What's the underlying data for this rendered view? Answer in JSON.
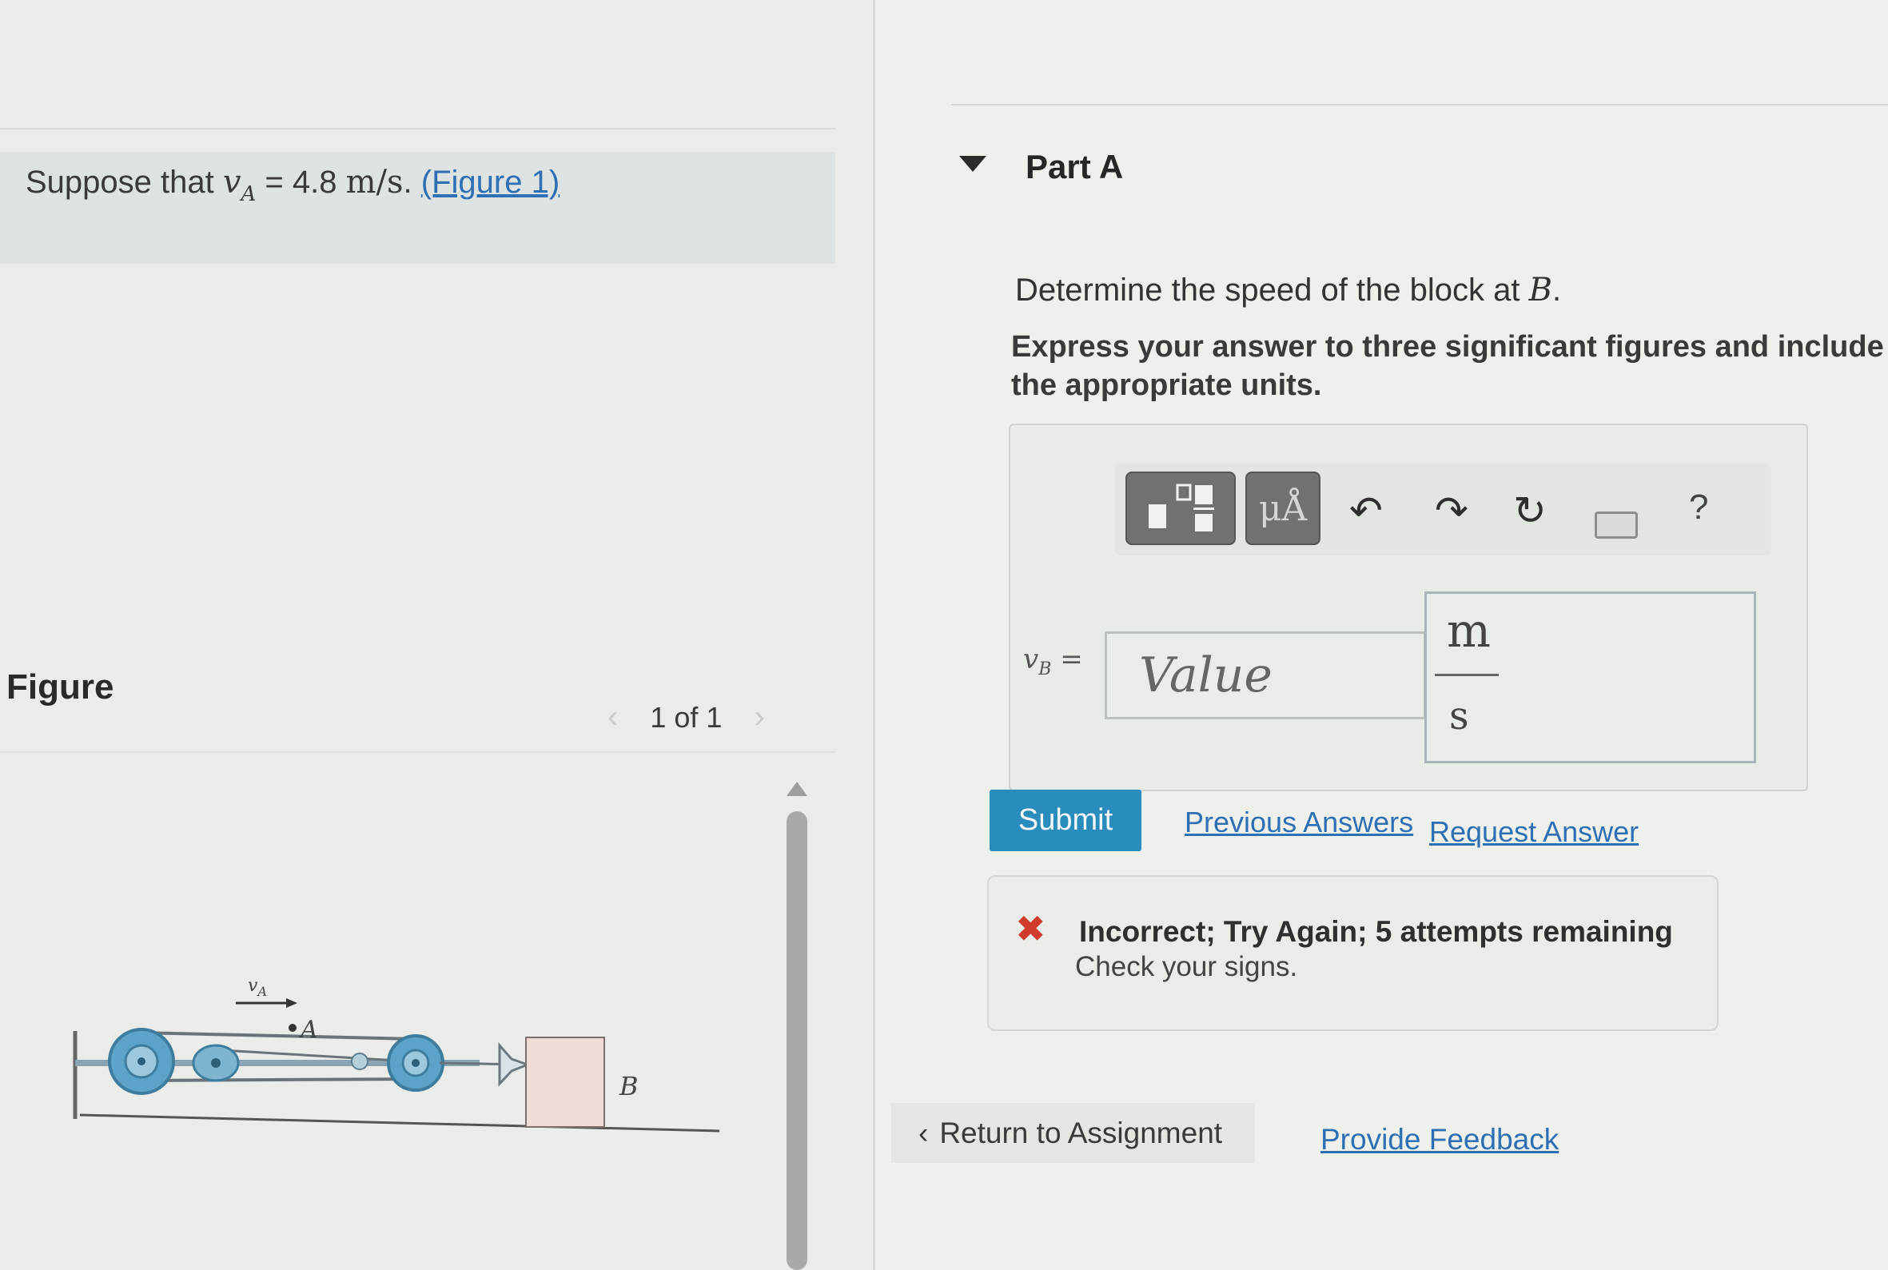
{
  "problem": {
    "intro_prefix": "Suppose that",
    "variable": "v",
    "variable_sub": "A",
    "equals_value": "= 4.8",
    "unit": "m/s",
    "period": ".",
    "figure_link": "(Figure 1)"
  },
  "figure_panel": {
    "heading": "Figure",
    "pager": {
      "prev_icon": "chevron-left-icon",
      "label": "1 of 1",
      "next_icon": "chevron-right-icon"
    },
    "diagram_labels": {
      "velocity": "v",
      "velocity_sub": "A",
      "point_a": "A",
      "block_b": "B"
    }
  },
  "part": {
    "title": "Part A",
    "question_prefix": "Determine the speed of the block at",
    "question_var": "B",
    "question_suffix": ".",
    "instruction": "Express your answer to three significant figures and include the appropriate units."
  },
  "answer": {
    "toolbar": {
      "template_icon": "fraction-template-icon",
      "units_label": "μÅ",
      "undo_icon": "undo-icon",
      "redo_icon": "redo-icon",
      "reset_icon": "reset-icon",
      "keyboard_icon": "keyboard-icon",
      "help_label": "?"
    },
    "variable": "v",
    "variable_sub": "B",
    "equals": "=",
    "value_placeholder": "Value",
    "unit_numerator": "m",
    "unit_denominator": "s"
  },
  "actions": {
    "submit": "Submit",
    "previous_answers": "Previous Answers",
    "request_answer": "Request Answer"
  },
  "feedback": {
    "icon": "x-error-icon",
    "title": "Incorrect; Try Again; 5 attempts remaining",
    "hint": "Check your signs."
  },
  "footer": {
    "return_label": "Return to Assignment",
    "provide_feedback": "Provide Feedback"
  },
  "colors": {
    "accent": "#2a8cbc",
    "link": "#2f6fb3",
    "error": "#d13b2d",
    "pulley": "#5ba3c9"
  }
}
